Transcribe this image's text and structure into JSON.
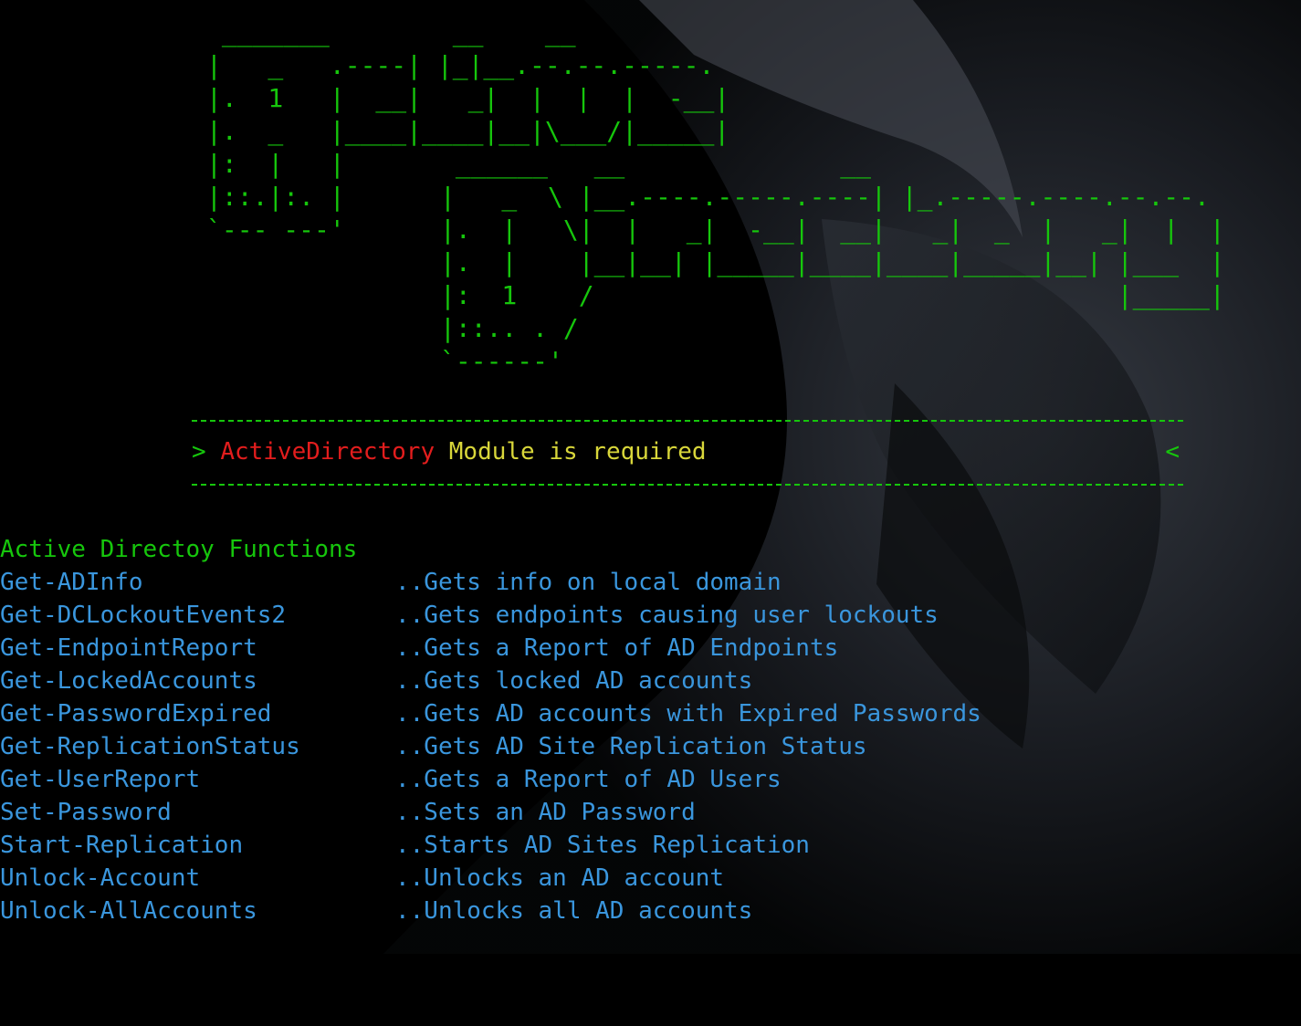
{
  "banner": {
    "logo_active_ascii": " _______        __    __\n|   _   .----| |_|__.--.--.-----.\n|.  1   |  __|   _|  |  |  |  -__|\n|.  _   |____|____|__|\\___/|_____|\n|:  |   |\n|::.|:. |\n`--- ---'",
    "logo_directory_ascii": " ______   __              __\n|   _  \\ |__.----.-----.----| |_.-----.----.--.--.\n|.  |   \\|  |   _|  -__|  __|   _|  _  |   _|  |  |\n|.  |    |__|__| |_____|____|____|_____|__| |___  |\n|:  1    /                                  |_____|\n|::.. . /\n`------'"
  },
  "notice": {
    "prefix": "> ",
    "module_name": "ActiveDirectory",
    "message": " Module is required",
    "suffix": "<"
  },
  "functions": {
    "heading": "Active Directoy Functions",
    "items": [
      {
        "name": "Get-ADInfo",
        "description": "..Gets info on local domain"
      },
      {
        "name": "Get-DCLockoutEvents2",
        "description": "..Gets endpoints causing user lockouts"
      },
      {
        "name": "Get-EndpointReport",
        "description": "..Gets a Report of AD Endpoints"
      },
      {
        "name": "Get-LockedAccounts",
        "description": "..Gets locked AD accounts"
      },
      {
        "name": "Get-PasswordExpired",
        "description": "..Gets AD accounts with Expired Passwords"
      },
      {
        "name": "Get-ReplicationStatus",
        "description": "..Gets AD Site Replication Status"
      },
      {
        "name": "Get-UserReport",
        "description": "..Gets a Report of AD Users"
      },
      {
        "name": "Set-Password",
        "description": "..Sets an AD Password"
      },
      {
        "name": "Start-Replication",
        "description": "..Starts AD Sites Replication"
      },
      {
        "name": "Unlock-Account",
        "description": "..Unlocks an AD account"
      },
      {
        "name": "Unlock-AllAccounts",
        "description": "..Unlocks all AD accounts"
      }
    ]
  },
  "colors": {
    "background": "#000000",
    "green": "#16c60c",
    "red": "#e21d1d",
    "yellow": "#d8d63a",
    "blue": "#3a96dd"
  }
}
